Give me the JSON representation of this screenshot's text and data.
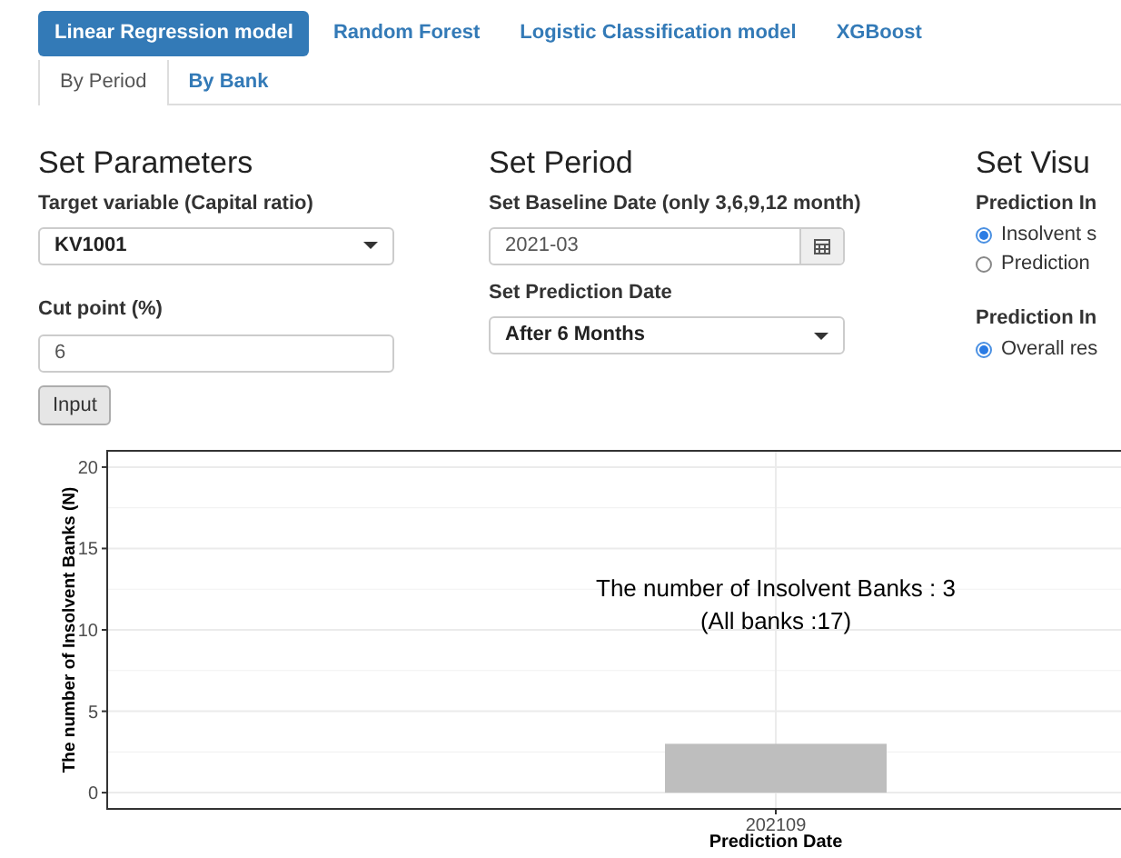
{
  "model_tabs": [
    {
      "label": "Linear Regression model",
      "selected": true
    },
    {
      "label": "Random Forest",
      "selected": false
    },
    {
      "label": "Logistic Classification model",
      "selected": false
    },
    {
      "label": "XGBoost",
      "selected": false
    }
  ],
  "view_tabs": [
    {
      "label": "By Period",
      "selected": true
    },
    {
      "label": "By Bank",
      "selected": false
    }
  ],
  "parameters": {
    "heading": "Set Parameters",
    "target_label": "Target variable (Capital ratio)",
    "target_value": "KV1001",
    "cut_label": "Cut point (%)",
    "cut_value": "6"
  },
  "period": {
    "heading": "Set Period",
    "baseline_label": "Set Baseline Date (only 3,6,9,12 month)",
    "baseline_value": "2021-03",
    "prediction_label": "Set Prediction Date",
    "prediction_value": "After 6 Months"
  },
  "visual": {
    "heading": "Set Visu",
    "groups": [
      {
        "label": "Prediction In",
        "options": [
          {
            "label": "Insolvent s",
            "selected": true
          },
          {
            "label": "Prediction",
            "selected": false
          }
        ]
      },
      {
        "label": "Prediction In",
        "options": [
          {
            "label": "Overall res",
            "selected": true
          }
        ]
      }
    ]
  },
  "input_button": "Input",
  "chart": {
    "chart_data": {
      "type": "bar",
      "xlabel": "Prediction Date",
      "ylabel": "The number of Insolvent Banks (N)",
      "categories": [
        "202109"
      ],
      "series": [
        {
          "color": "#bebebe",
          "values": [
            3
          ]
        }
      ],
      "grid": true,
      "ylim": [
        -1,
        21
      ],
      "yticks": [
        0,
        5,
        10,
        15,
        20
      ],
      "annotations": [
        "The number of Insolvent Banks : 3",
        "(All banks :17)"
      ]
    }
  }
}
